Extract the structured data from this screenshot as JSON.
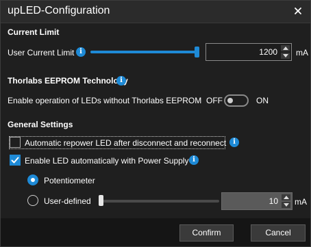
{
  "window": {
    "title": "upLED-Configuration"
  },
  "current_limit": {
    "heading": "Current Limit",
    "label": "User Current Limit",
    "value": "1200",
    "unit": "mA",
    "slider_fraction": 1.0
  },
  "eeprom": {
    "heading": "Thorlabs EEPROM Technology",
    "label": "Enable operation of LEDs without Thorlabs EEPROM",
    "off_label": "OFF",
    "on_label": "ON",
    "state": "off"
  },
  "general": {
    "heading": "General Settings",
    "auto_repower_label": "Automatic repower LED after disconnect and reconnect",
    "auto_repower_checked": false,
    "enable_with_supply_label": "Enable LED automatically with Power Supply",
    "enable_with_supply_checked": true,
    "potentiometer_label": "Potentiometer",
    "user_defined_label": "User-defined",
    "selected_mode": "Potentiometer",
    "user_defined_value": "10",
    "user_defined_unit": "mA",
    "user_defined_slider_fraction": 0.0
  },
  "footer": {
    "confirm_label": "Confirm",
    "cancel_label": "Cancel"
  },
  "colors": {
    "accent": "#1e8ad6",
    "background": "#1f1f1f",
    "footer": "#151515"
  },
  "icons": [
    "close-icon",
    "info-icon",
    "chevron-up-icon",
    "chevron-down-icon",
    "checkmark-icon"
  ]
}
